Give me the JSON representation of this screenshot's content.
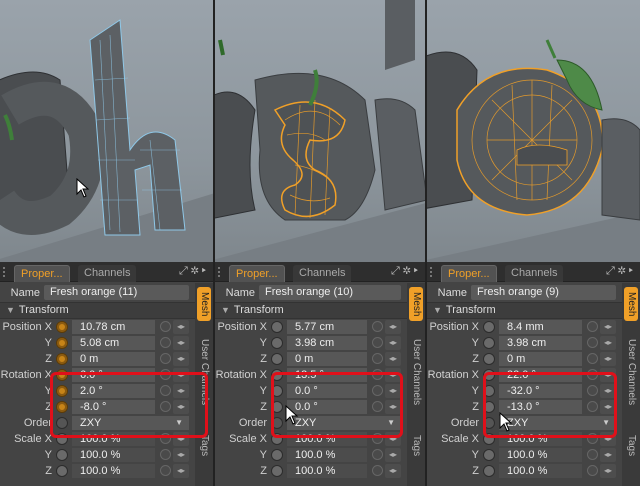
{
  "panels": [
    {
      "tabs": {
        "active": "Proper...",
        "inactive": "Channels"
      },
      "name": {
        "label": "Name",
        "value": "Fresh orange (11)"
      },
      "section": "Transform",
      "position": [
        {
          "axis": "Position X",
          "value": "10.78 cm"
        },
        {
          "axis": "Y",
          "value": "5.08 cm"
        },
        {
          "axis": "Z",
          "value": "0 m"
        }
      ],
      "rotation": [
        {
          "axis": "Rotation X",
          "value": "6.0 °"
        },
        {
          "axis": "Y",
          "value": "2.0 °"
        },
        {
          "axis": "Z",
          "value": "-8.0 °"
        }
      ],
      "order": {
        "label": "Order",
        "value": "ZXY"
      },
      "scale": [
        {
          "axis": "Scale X",
          "value": "100.0 %"
        },
        {
          "axis": "Y",
          "value": "100.0 %"
        },
        {
          "axis": "Z",
          "value": "100.0 %"
        }
      ],
      "side_tabs": [
        "Mesh",
        "User Channels",
        "Tags"
      ]
    },
    {
      "tabs": {
        "active": "Proper...",
        "inactive": "Channels"
      },
      "name": {
        "label": "Name",
        "value": "Fresh orange (10)"
      },
      "section": "Transform",
      "position": [
        {
          "axis": "Position X",
          "value": "5.77 cm"
        },
        {
          "axis": "Y",
          "value": "3.98 cm"
        },
        {
          "axis": "Z",
          "value": "0 m"
        }
      ],
      "rotation": [
        {
          "axis": "Rotation X",
          "value": "13.5 °"
        },
        {
          "axis": "Y",
          "value": "0.0 °"
        },
        {
          "axis": "Z",
          "value": "0.0 °"
        }
      ],
      "order": {
        "label": "Order",
        "value": "ZXY"
      },
      "scale": [
        {
          "axis": "Scale X",
          "value": "100.0 %"
        },
        {
          "axis": "Y",
          "value": "100.0 %"
        },
        {
          "axis": "Z",
          "value": "100.0 %"
        }
      ],
      "side_tabs": [
        "Mesh",
        "User Channels",
        "Tags"
      ]
    },
    {
      "tabs": {
        "active": "Proper...",
        "inactive": "Channels"
      },
      "name": {
        "label": "Name",
        "value": "Fresh orange (9)"
      },
      "section": "Transform",
      "position": [
        {
          "axis": "Position X",
          "value": "8.4 mm"
        },
        {
          "axis": "Y",
          "value": "3.98 cm"
        },
        {
          "axis": "Z",
          "value": "0 m"
        }
      ],
      "rotation": [
        {
          "axis": "Rotation X",
          "value": "22.0 °"
        },
        {
          "axis": "Y",
          "value": "-32.0 °"
        },
        {
          "axis": "Z",
          "value": "-13.0 °"
        }
      ],
      "order": {
        "label": "Order",
        "value": "ZXY"
      },
      "scale": [
        {
          "axis": "Scale X",
          "value": "100.0 %"
        },
        {
          "axis": "Y",
          "value": "100.0 %"
        },
        {
          "axis": "Z",
          "value": "100.0 %"
        }
      ],
      "side_tabs": [
        "Mesh",
        "User Channels",
        "Tags"
      ]
    }
  ],
  "colors": {
    "accent": "#f0a028",
    "highlight": "#e0101a",
    "selection_wire": "#f0a028",
    "wire": "#8fc8e8"
  }
}
